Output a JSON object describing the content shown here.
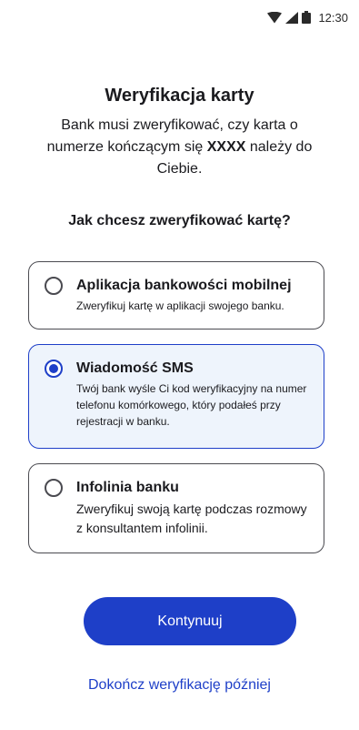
{
  "status_bar": {
    "time": "12:30",
    "icons": [
      "wifi-icon",
      "signal-icon",
      "battery-icon"
    ]
  },
  "header": {
    "title": "Weryfikacja karty",
    "description_part1": "Bank musi zweryfikować, czy karta o numerze kończącym się ",
    "card_suffix": "XXXX",
    "description_part2": " należy do Ciebie."
  },
  "question": "Jak chcesz zweryfikować kartę?",
  "options": [
    {
      "id": "app",
      "title": "Aplikacja bankowości mobilnej",
      "description": "Zweryfikuj kartę w aplikacji swojego banku.",
      "selected": false
    },
    {
      "id": "sms",
      "title": "Wiadomość SMS",
      "description": "Twój bank wyśle Ci kod weryfikacyjny na numer telefonu komórkowego, który  podałeś przy rejestracji w banku.",
      "selected": true
    },
    {
      "id": "info",
      "title": "Infolinia banku",
      "description": "Zweryfikuj swoją kartę podczas rozmowy z konsultantem infolinii.",
      "selected": false
    }
  ],
  "actions": {
    "continue_label": "Kontynuuj",
    "later_label": "Dokończ weryfikację później"
  },
  "colors": {
    "accent": "#1e3fc8",
    "selected_background": "#eef4fc",
    "border": "#4a4a50"
  }
}
